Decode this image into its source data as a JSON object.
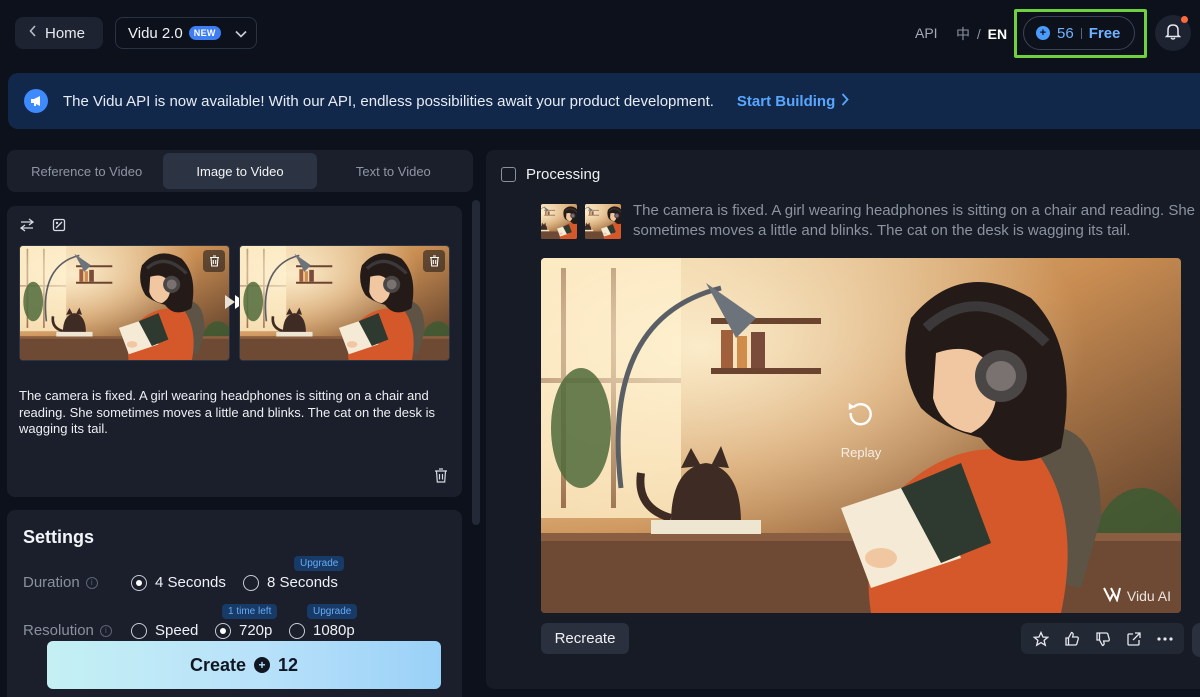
{
  "header": {
    "home_label": "Home",
    "model_label": "Vidu 2.0",
    "new_badge": "NEW",
    "api_label": "API",
    "lang_zh": "中",
    "lang_sep": "/",
    "lang_en": "EN",
    "credits": "56",
    "plan": "Free"
  },
  "banner": {
    "text": "The Vidu API is now available! With our API, endless possibilities await your product development.",
    "link": "Start Building"
  },
  "tabs": [
    {
      "label": "Reference to Video",
      "active": false
    },
    {
      "label": "Image to Video",
      "active": true
    },
    {
      "label": "Text to Video",
      "active": false
    }
  ],
  "prompt": {
    "text": "The camera is fixed. A girl wearing headphones is sitting on a chair and reading. She sometimes moves a little and blinks. The cat on the desk is wagging its tail."
  },
  "settings": {
    "title": "Settings",
    "duration_label": "Duration",
    "duration_options": [
      "4 Seconds",
      "8 Seconds"
    ],
    "duration_selected": "4 Seconds",
    "duration_upgrade_tag": "Upgrade",
    "resolution_label": "Resolution",
    "resolution_options": [
      "Speed",
      "720p",
      "1080p"
    ],
    "resolution_selected": "720p",
    "resolution_720_tag": "1 time left",
    "resolution_1080_tag": "Upgrade"
  },
  "create": {
    "label": "Create",
    "cost": "12"
  },
  "result": {
    "status": "Processing",
    "prompt": "The camera is fixed. A girl wearing headphones is sitting on a chair and reading. She sometimes moves a little and blinks. The cat on the desk is wagging its tail.",
    "replay_label": "Replay",
    "watermark": "Vidu AI",
    "recreate_label": "Recreate"
  },
  "colors": {
    "accent": "#58a6ff",
    "highlight_box": "#6fd13e",
    "banner_bg": "#12284a",
    "create_gradient_start": "#c4f0f4",
    "create_gradient_end": "#9ad1f7"
  },
  "icons": [
    "chevron-left-icon",
    "chevron-down-icon",
    "coin-icon",
    "bell-icon",
    "megaphone-icon",
    "chevron-right-icon",
    "swap-icon",
    "crop-icon",
    "trash-icon",
    "play-arrow-icon",
    "info-icon",
    "replay-icon",
    "vidu-logo-icon",
    "star-icon",
    "thumbs-up-icon",
    "thumbs-down-icon",
    "share-icon",
    "more-icon"
  ]
}
